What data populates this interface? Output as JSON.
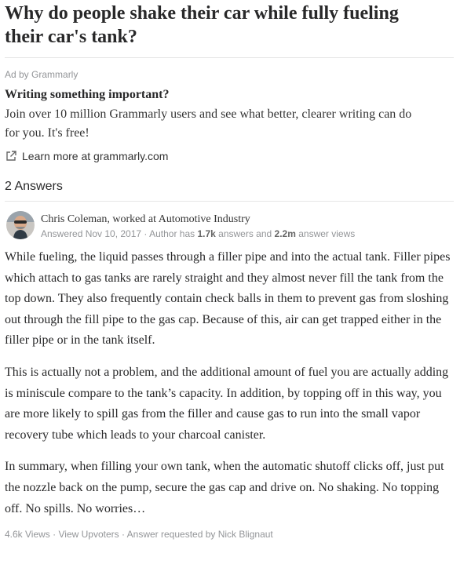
{
  "question": {
    "title_line1": "Why do people shake their car while fully fueling",
    "title_line2": "their car's tank?"
  },
  "ad": {
    "by": "Ad by Grammarly",
    "headline": "Writing something important?",
    "body_line1": "Join over 10 million Grammarly users and see what better, clearer writing can do",
    "body_line2": "for you. It's free!",
    "link_label": "Learn more at grammarly.com",
    "link_icon": "external-link-icon"
  },
  "answers": {
    "count_label": "2 Answers"
  },
  "answer": {
    "author_name": "Chris Coleman",
    "author_credential": ", worked at Automotive Industry",
    "answered_prefix": "Answered Nov 10, 2017 · Author has ",
    "answer_count": "1.7k",
    "answers_mid": " answers and ",
    "view_count": "2.2m",
    "answers_suffix": " answer views",
    "paragraph1": "While fueling, the liquid passes through a filler pipe and into the actual tank. Filler pipes which attach to gas tanks are rarely straight and they almost never fill the tank from the top down. They also frequently contain check balls in them to prevent gas from sloshing out through the fill pipe to the gas cap. Because of this, air can get trapped either in the filler pipe or in the tank itself.",
    "paragraph2": "This is actually not a problem, and the additional amount of fuel you are actually adding is miniscule compare to the tank’s capacity. In addition, by topping off in this way, you are more likely to spill gas from the filler and cause gas to run into the small vapor recovery tube which leads to your charcoal canister.",
    "paragraph3": "In summary, when filling your own tank, when the automatic shutoff clicks off, just put the nozzle back on the pump, secure the gas cap and drive on. No shaking. No topping off. No spills. No worries…",
    "footer_views": "4.6k Views",
    "footer_sep1": " · ",
    "footer_upvoters": "View Upvoters",
    "footer_sep2": " · ",
    "footer_requested": "Answer requested by Nick Blignaut"
  }
}
